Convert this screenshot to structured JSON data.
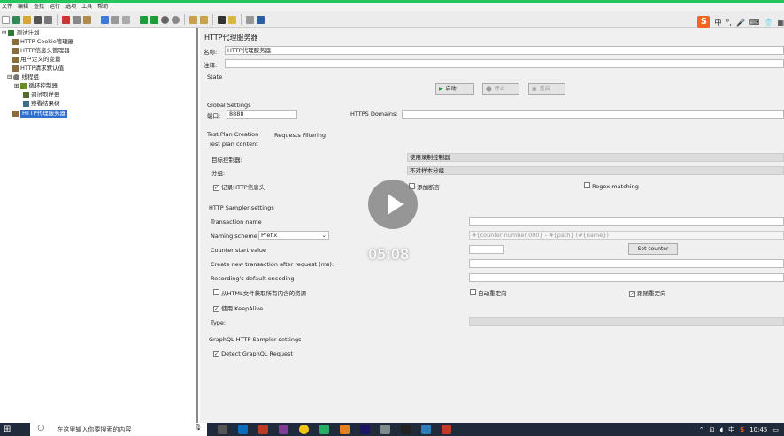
{
  "menubar": [
    "文件",
    "编辑",
    "查找",
    "运行",
    "选项",
    "工具",
    "帮助"
  ],
  "tree": {
    "items": [
      {
        "label": "测试计划",
        "depth": 0
      },
      {
        "label": "HTTP Cookie管理器",
        "depth": 1
      },
      {
        "label": "HTTP信息头管理器",
        "depth": 1
      },
      {
        "label": "用户定义的变量",
        "depth": 1
      },
      {
        "label": "HTTP请求默认值",
        "depth": 1
      },
      {
        "label": "线程组",
        "depth": 1
      },
      {
        "label": "循环控制器",
        "depth": 2
      },
      {
        "label": "调试取样器",
        "depth": 2
      },
      {
        "label": "察看结果树",
        "depth": 2
      },
      {
        "label": "HTTP代理服务器",
        "depth": 1,
        "selected": true
      }
    ]
  },
  "panel": {
    "title": "HTTP代理服务器",
    "name_label": "名称:",
    "name_value": "HTTP代理服务器",
    "comment_label": "注释:",
    "state_label": "State",
    "start_label": "启动",
    "stop_label": "停止",
    "restart_label": "重启",
    "global_settings": "Global Settings",
    "port_label": "端口:",
    "port_value": "8888",
    "https_label": "HTTPS Domains:",
    "tab1": "Test Plan Creation",
    "tab2": "Requests Filtering",
    "test_plan_content": "Test plan content",
    "target_label": "目标控制器:",
    "target_value": "使用录制控制器",
    "group_label": "分组:",
    "group_value": "不对样本分组",
    "record_headers": "记录HTTP信息头",
    "add_assertions": "添加断言",
    "regex_matching": "Regex matching",
    "sampler_settings": "HTTP Sampler settings",
    "transaction_name": "Transaction name",
    "naming_scheme": "Naming scheme",
    "naming_value": "Prefix",
    "naming_pattern": "#{counter,number,000} - #{path} (#{name})",
    "counter_start": "Counter start value",
    "set_counter": "Set counter",
    "create_new_tx": "Create new transaction after request (ms):",
    "default_encoding": "Recording's default encoding",
    "retrieve_resources": "从HTML文件获取所有内含的资源",
    "auto_redirect": "自动重定向",
    "follow_redirect": "跟随重定向",
    "keepalive": "使用 KeepAlive",
    "type_label": "Type:",
    "graphql_settings": "GraphQL HTTP Sampler settings",
    "detect_graphql": "Detect GraphQL Request"
  },
  "overlay": {
    "time": "05:08"
  },
  "taskbar": {
    "search_placeholder": "在这里输入你要搜索的内容",
    "time": "10:45",
    "ime_char": "中",
    "ime_logo": "S",
    "ime_mode": "中"
  }
}
